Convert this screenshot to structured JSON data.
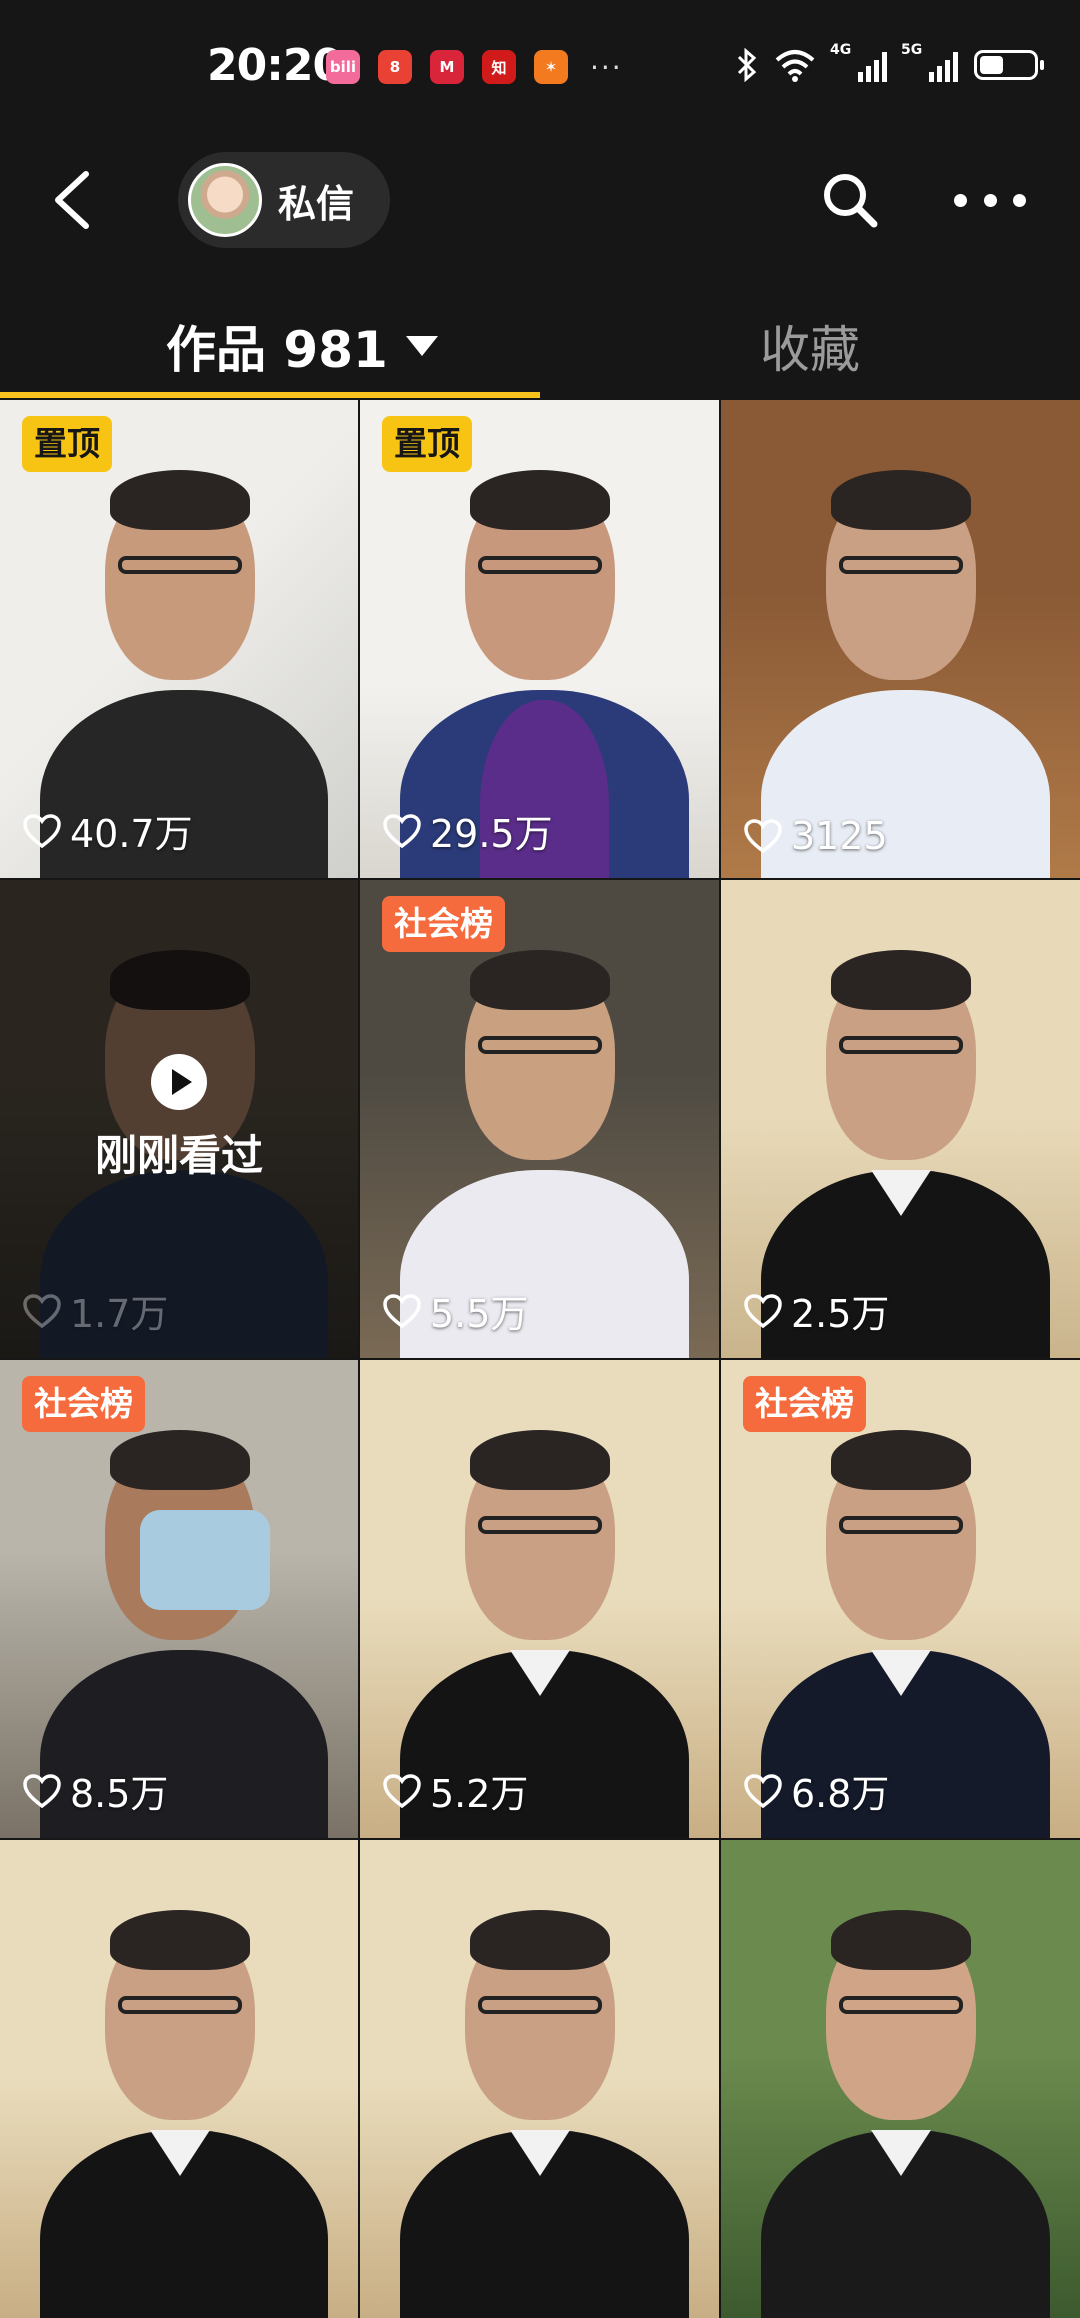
{
  "status_bar": {
    "time": "20:20",
    "app_icons": [
      {
        "name": "bilibili-icon",
        "color": "#f26b9a",
        "glyph": "bili"
      },
      {
        "name": "app-red-icon",
        "color": "#e94235",
        "glyph": "8"
      },
      {
        "name": "app-mall-icon",
        "color": "#d9253a",
        "glyph": "M"
      },
      {
        "name": "zhihu-icon",
        "color": "#d11b1b",
        "glyph": "知"
      },
      {
        "name": "app-orange-icon",
        "color": "#f47a20",
        "glyph": "✶"
      }
    ],
    "more": "···",
    "signal_labels": [
      "4G",
      "5G"
    ],
    "battery_level": 0.45
  },
  "header": {
    "dm_label": "私信"
  },
  "tabs": {
    "works_label": "作品 981",
    "favorites_label": "收藏",
    "accent": "#f7c31c"
  },
  "grid": [
    {
      "badge": "置顶",
      "badge_type": "pin",
      "likes": "40.7万"
    },
    {
      "badge": "置顶",
      "badge_type": "pin",
      "likes": "29.5万"
    },
    {
      "badge": "",
      "badge_type": "",
      "likes": "3125"
    },
    {
      "badge": "",
      "badge_type": "",
      "likes": "1.7万",
      "watched": "刚刚看过"
    },
    {
      "badge": "社会榜",
      "badge_type": "hot",
      "likes": "5.5万"
    },
    {
      "badge": "",
      "badge_type": "",
      "likes": "2.5万"
    },
    {
      "badge": "社会榜",
      "badge_type": "hot",
      "likes": "8.5万"
    },
    {
      "badge": "",
      "badge_type": "",
      "likes": "5.2万"
    },
    {
      "badge": "社会榜",
      "badge_type": "hot",
      "likes": "6.8万"
    },
    {
      "badge": "",
      "badge_type": "",
      "likes": ""
    },
    {
      "badge": "",
      "badge_type": "",
      "likes": ""
    },
    {
      "badge": "",
      "badge_type": "",
      "likes": ""
    }
  ]
}
